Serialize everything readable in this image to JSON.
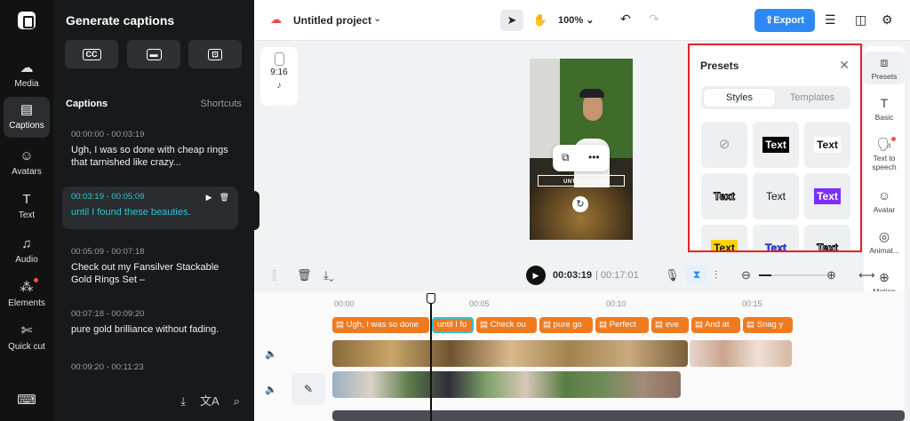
{
  "nav": {
    "items": [
      {
        "label": "Media",
        "icon": "cloud-upload-icon"
      },
      {
        "label": "Captions",
        "icon": "captions-icon"
      },
      {
        "label": "Avatars",
        "icon": "avatar-icon"
      },
      {
        "label": "Text",
        "icon": "text-icon"
      },
      {
        "label": "Audio",
        "icon": "music-icon"
      },
      {
        "label": "Elements",
        "icon": "elements-icon"
      },
      {
        "label": "Quick cut",
        "icon": "quick-cut-icon"
      }
    ]
  },
  "panel": {
    "title": "Generate captions",
    "captions_heading": "Captions",
    "shortcuts": "Shortcuts",
    "captions": [
      {
        "time": "00:00:00 - 00:03:19",
        "text": "Ugh, I was so done with cheap rings that tarnished like crazy..."
      },
      {
        "time": "00:03:19 - 00:05:09",
        "text": "until I found these beauties."
      },
      {
        "time": "00:05:09 - 00:07:18",
        "text": "Check out my Fansilver Stackable Gold Rings Set –"
      },
      {
        "time": "00:07:18 - 00:09:20",
        "text": "pure gold brilliance without fading."
      },
      {
        "time": "00:09:20 - 00:11:23",
        "text": ""
      }
    ]
  },
  "topbar": {
    "project": "Untitled project",
    "zoom": "100%",
    "export": "Export"
  },
  "canvas": {
    "ratio": "9:16",
    "overlay_text": "UNTIL I FOUND"
  },
  "presets": {
    "title": "Presets",
    "tabs": [
      "Styles",
      "Templates"
    ],
    "tile_text": "Text"
  },
  "rail": {
    "items": [
      "Presets",
      "Basic",
      "Text to speech",
      "Avatar",
      "Animat...",
      "Motion tracking"
    ]
  },
  "timeline": {
    "current": "00:03:19",
    "total": "00:17:01",
    "ticks": [
      "00:00",
      "00:05",
      "00:10",
      "00:15"
    ],
    "clips": [
      "Ugh, I was so done",
      "until I fo",
      "Check ou",
      "pure go",
      "Perfect",
      "eve",
      "And at",
      "Snag y"
    ]
  },
  "colors": {
    "accent": "#2f88f5",
    "caption_clip": "#f07a1f",
    "active_caption": "#2fc1d4",
    "highlight_border": "#e0242b"
  }
}
